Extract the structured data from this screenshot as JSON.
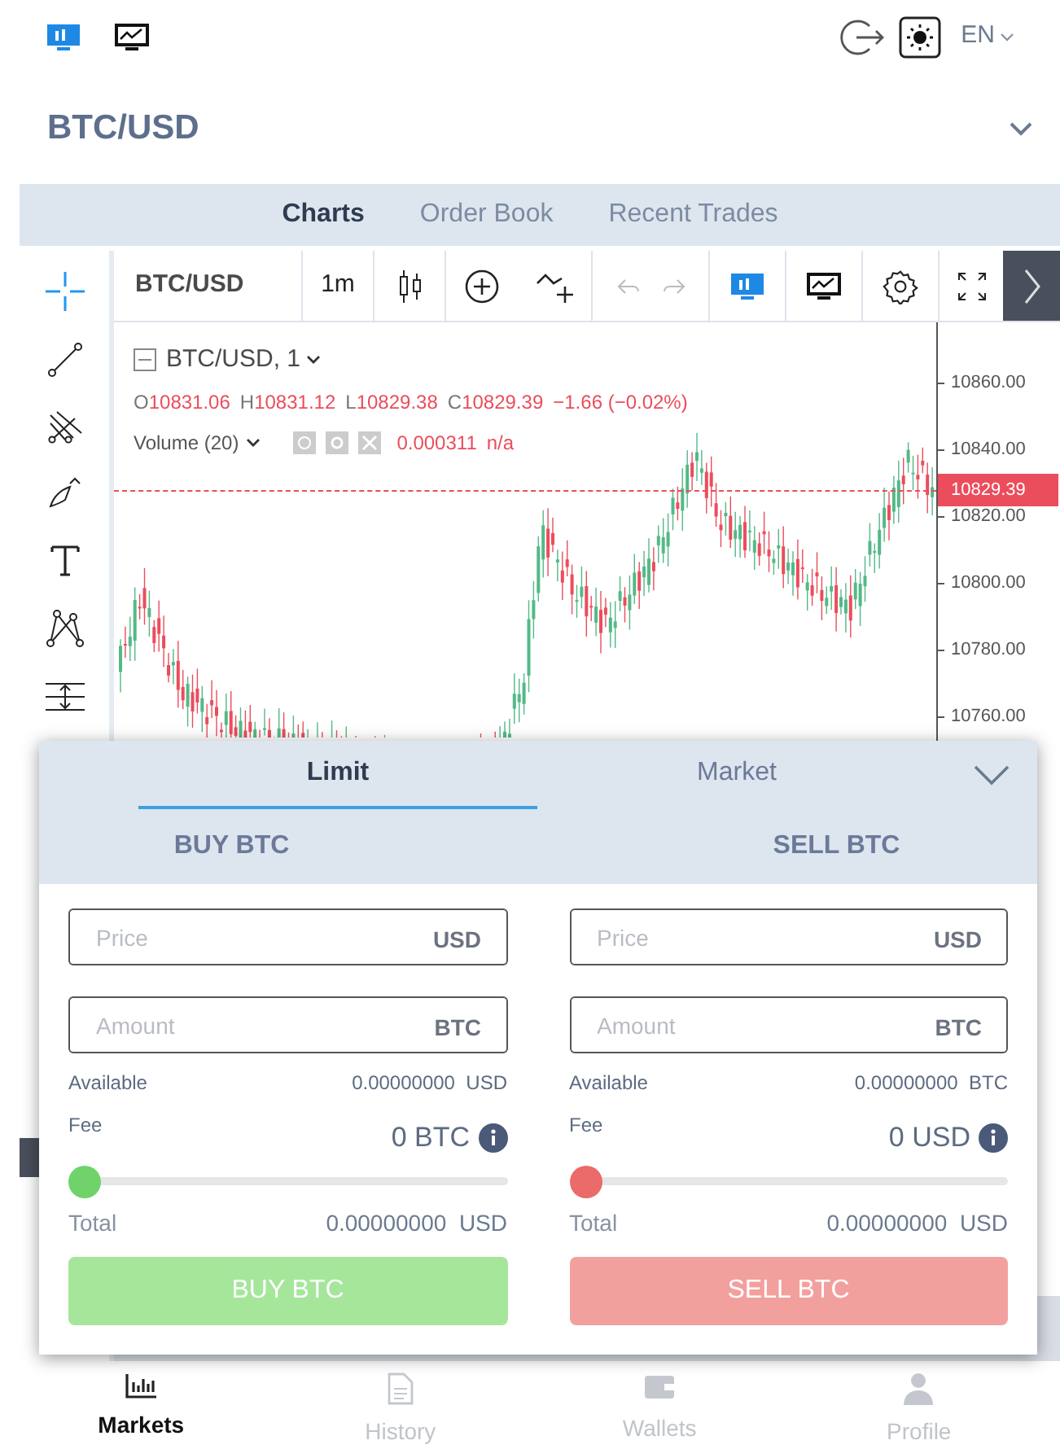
{
  "header": {
    "language": "EN"
  },
  "pair": {
    "title": "BTC/USD"
  },
  "tabs": [
    {
      "label": "Charts",
      "selected": true
    },
    {
      "label": "Order Book",
      "selected": false
    },
    {
      "label": "Recent Trades",
      "selected": false
    }
  ],
  "chart": {
    "symbol": "BTC/USD",
    "interval": "1m",
    "legend_title": "BTC/USD, 1",
    "ohlc": [
      {
        "label": "O",
        "value": "10831.06"
      },
      {
        "label": "H",
        "value": "10831.12"
      },
      {
        "label": "L",
        "value": "10829.38"
      },
      {
        "label": "C",
        "value": "10829.39"
      }
    ],
    "change": "−1.66 (−0.02%)",
    "volume_label": "Volume (20)",
    "volume_value": "0.000311",
    "volume_extra": "n/a",
    "price_axis": [
      "10860.00",
      "10840.00",
      "10820.00",
      "10800.00",
      "10780.00",
      "10760.00"
    ],
    "current_price": "10829.39"
  },
  "order": {
    "types": [
      {
        "label": "Limit",
        "selected": true
      },
      {
        "label": "Market",
        "selected": false
      }
    ],
    "sides": [
      {
        "kind": "buy",
        "title": "BUY BTC",
        "price_placeholder": "Price",
        "price_unit": "USD",
        "amount_placeholder": "Amount",
        "amount_unit": "BTC",
        "available_label": "Available",
        "available_value": "0.00000000",
        "available_unit": "USD",
        "fee_label": "Fee",
        "fee_value": "0 BTC",
        "level": 0,
        "total_label": "Total",
        "total_value": "0.00000000",
        "total_unit": "USD",
        "button": "BUY BTC",
        "disabled": true
      },
      {
        "kind": "sell",
        "title": "SELL BTC",
        "price_placeholder": "Price",
        "price_unit": "USD",
        "amount_placeholder": "Amount",
        "amount_unit": "BTC",
        "available_label": "Available",
        "available_value": "0.00000000",
        "available_unit": "BTC",
        "fee_label": "Fee",
        "fee_value": "0 USD",
        "level": 0,
        "total_label": "Total",
        "total_value": "0.00000000",
        "total_unit": "USD",
        "button": "SELL BTC",
        "disabled": true
      }
    ]
  },
  "nav": [
    {
      "label": "Markets",
      "selected": true
    },
    {
      "label": "History",
      "selected": false
    },
    {
      "label": "Wallets",
      "selected": false
    },
    {
      "label": "Profile",
      "selected": false
    }
  ]
}
